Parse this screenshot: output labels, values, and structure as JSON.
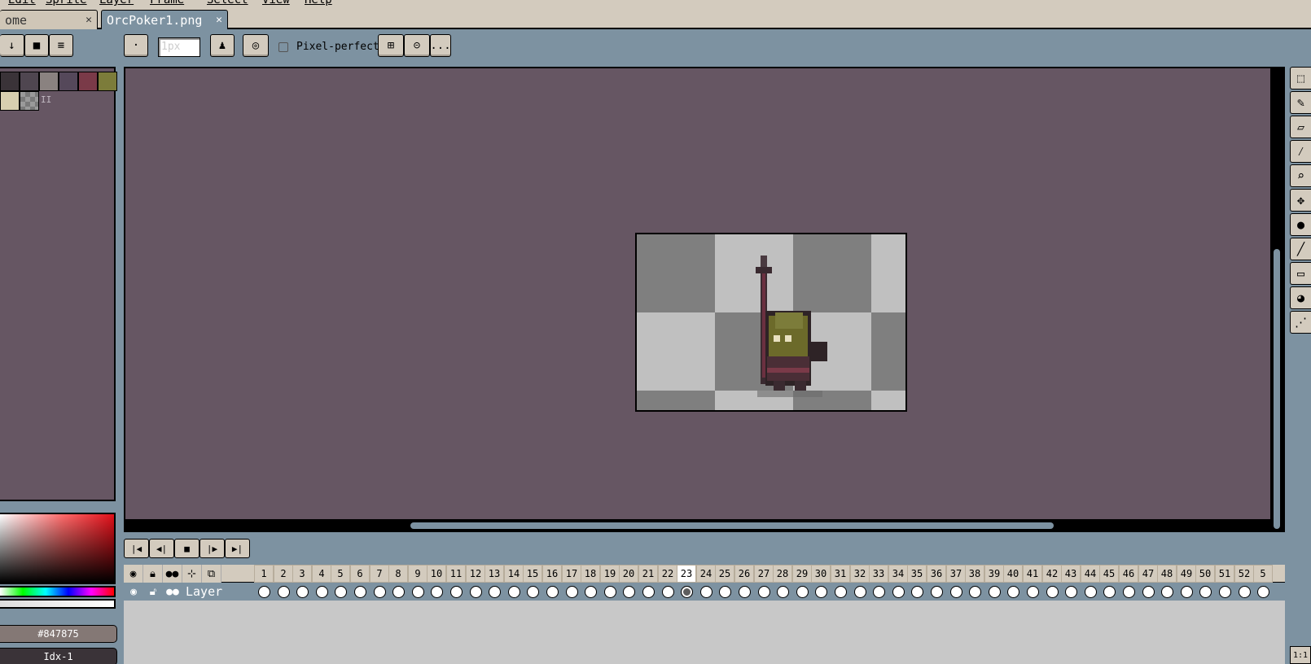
{
  "menu": [
    "Edit",
    "Sprite",
    "Layer",
    "Frame",
    "Select",
    "View",
    "Help"
  ],
  "tabs": [
    {
      "label": "ome",
      "close": "✕"
    },
    {
      "label": "OrcPoker1.png",
      "close": "✕"
    }
  ],
  "context": {
    "brush_size_value": "",
    "brush_size_placeholder": "1px",
    "pixel_perfect_label": "Pixel-perfect",
    "more_label": "..."
  },
  "palette": {
    "colors": [
      "#3a3338",
      "#4f4650",
      "#8a8280",
      "#55485a",
      "#7a3a48",
      "#7c7c3a",
      "#d8cfb0",
      "#7a7a7a"
    ],
    "options_label": "II"
  },
  "color": {
    "hex_label": "#847875",
    "index_label": "Idx-1"
  },
  "timeline": {
    "layer_name": "Layer",
    "current_frame": 23,
    "frames": [
      "1",
      "2",
      "3",
      "4",
      "5",
      "6",
      "7",
      "8",
      "9",
      "10",
      "11",
      "12",
      "13",
      "14",
      "15",
      "16",
      "17",
      "18",
      "19",
      "20",
      "21",
      "22",
      "23",
      "24",
      "25",
      "26",
      "27",
      "28",
      "29",
      "30",
      "31",
      "32",
      "33",
      "34",
      "35",
      "36",
      "37",
      "38",
      "39",
      "40",
      "41",
      "42",
      "43",
      "44",
      "45",
      "46",
      "47",
      "48",
      "49",
      "50",
      "51",
      "52",
      "5"
    ]
  },
  "zoom_label": "1:1"
}
